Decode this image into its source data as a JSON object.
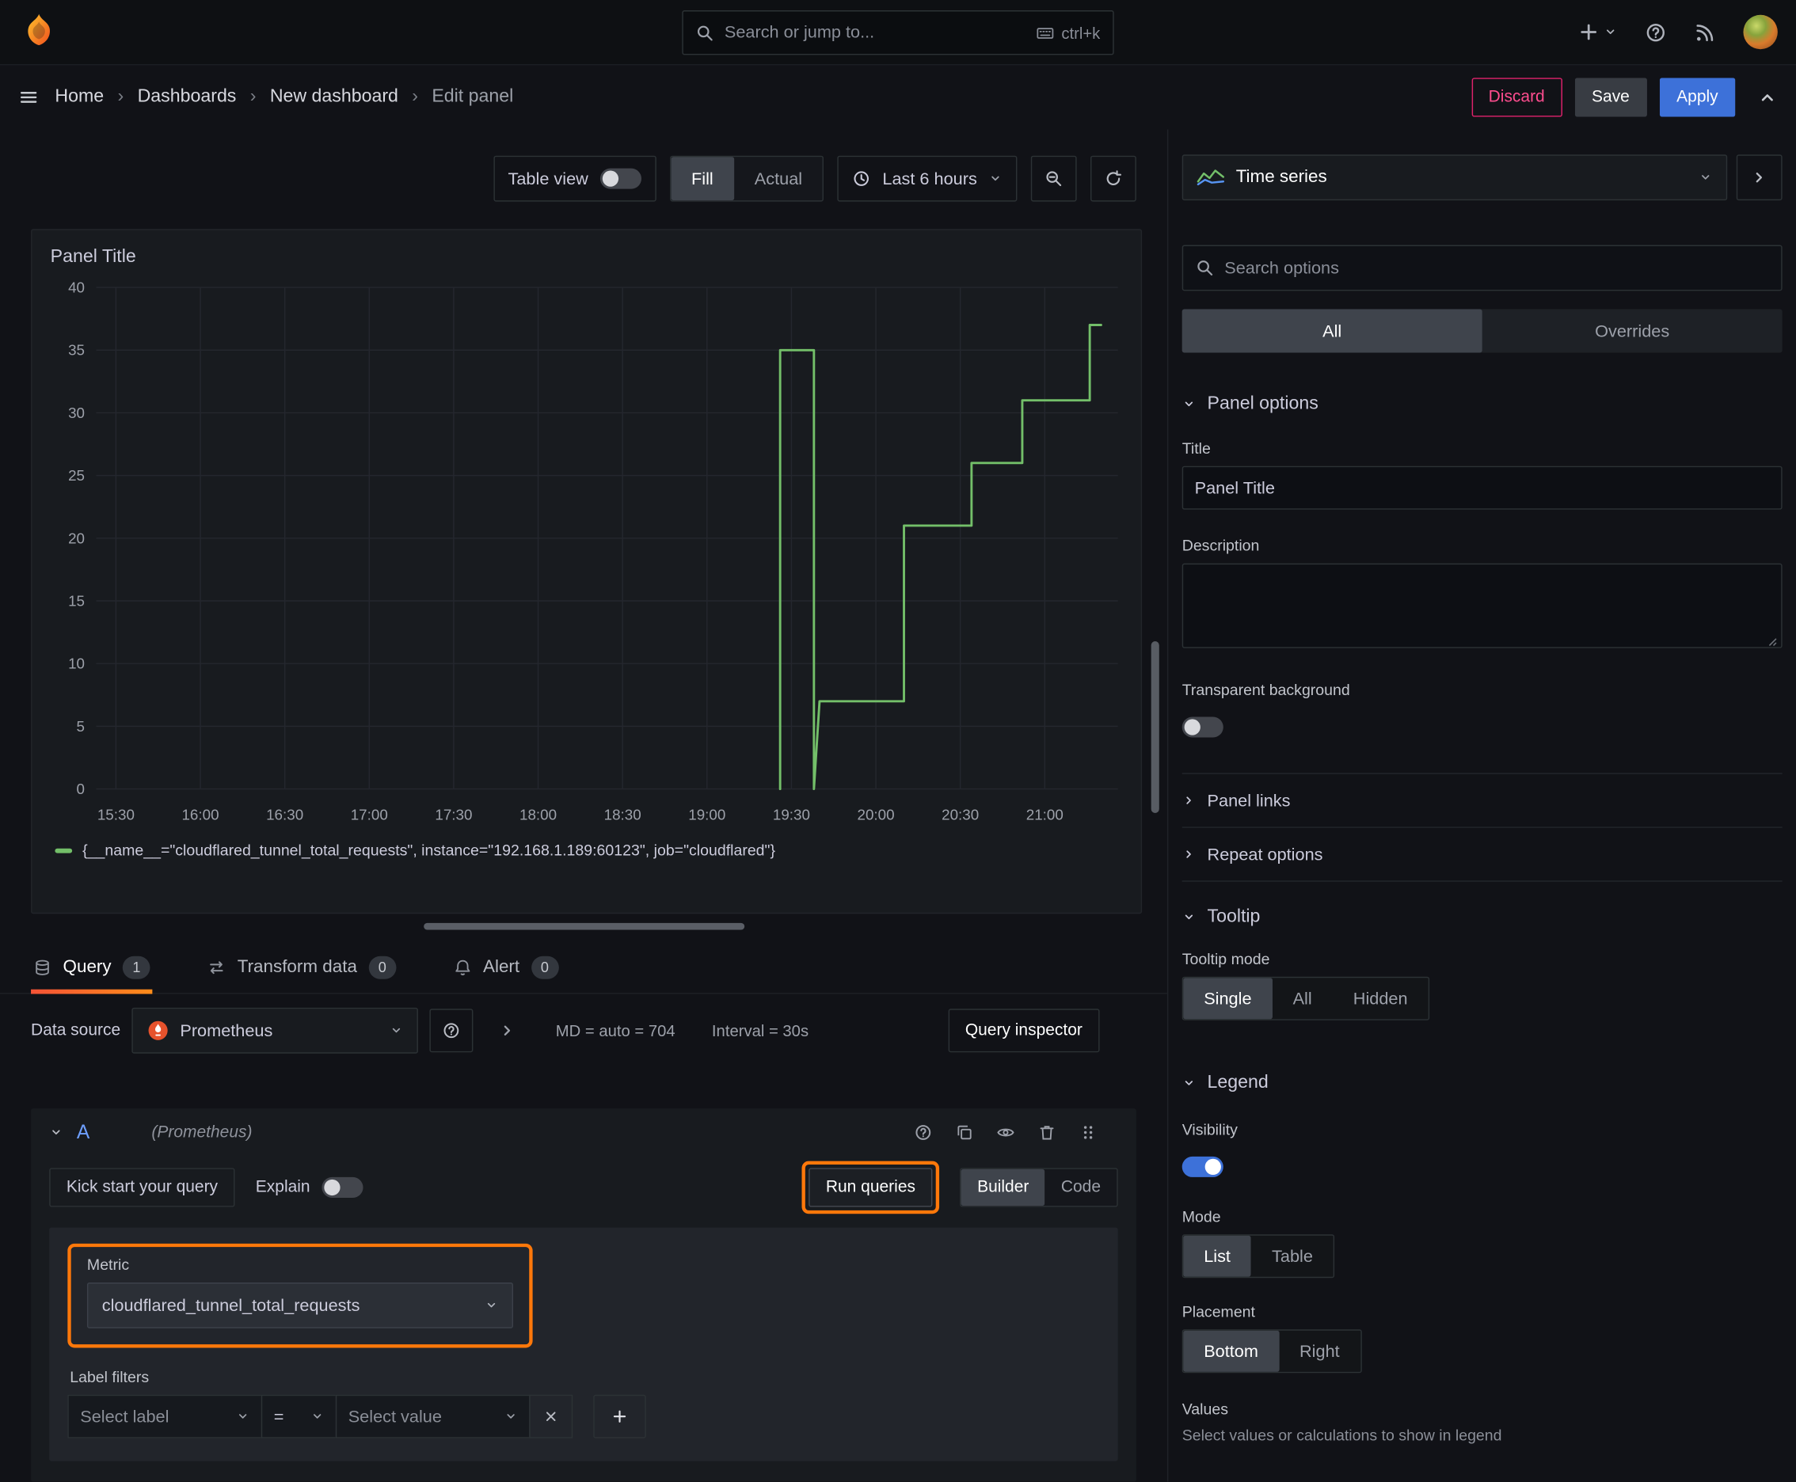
{
  "topnav": {
    "search_placeholder": "Search or jump to...",
    "shortcut": "ctrl+k"
  },
  "breadcrumb": {
    "items": [
      "Home",
      "Dashboards",
      "New dashboard",
      "Edit panel"
    ],
    "discard": "Discard",
    "save": "Save",
    "apply": "Apply"
  },
  "toolbar": {
    "table_view": "Table view",
    "fill": "Fill",
    "actual": "Actual",
    "time_range": "Last 6 hours"
  },
  "panel": {
    "title": "Panel Title",
    "legend": "{__name__=\"cloudflared_tunnel_total_requests\", instance=\"192.168.1.189:60123\", job=\"cloudflared\"}"
  },
  "chart_data": {
    "type": "line",
    "step": true,
    "title": "Panel Title",
    "x_ticks": [
      "15:30",
      "16:00",
      "16:30",
      "17:00",
      "17:30",
      "18:00",
      "18:30",
      "19:00",
      "19:30",
      "20:00",
      "20:30",
      "21:00"
    ],
    "x_range": [
      "15:23",
      "21:26"
    ],
    "y_ticks": [
      0,
      5,
      10,
      15,
      20,
      25,
      30,
      35,
      40
    ],
    "ylim": [
      0,
      40
    ],
    "grid": true,
    "legend_position": "bottom",
    "series": [
      {
        "name": "{__name__=\"cloudflared_tunnel_total_requests\", instance=\"192.168.1.189:60123\", job=\"cloudflared\"}",
        "color": "#73bf69",
        "points": [
          [
            "19:26",
            0
          ],
          [
            "19:26",
            35
          ],
          [
            "19:38",
            35
          ],
          [
            "19:38",
            0
          ],
          [
            "19:40",
            7
          ],
          [
            "20:10",
            7
          ],
          [
            "20:10",
            21
          ],
          [
            "20:34",
            21
          ],
          [
            "20:34",
            26
          ],
          [
            "20:52",
            26
          ],
          [
            "20:52",
            31
          ],
          [
            "21:16",
            31
          ],
          [
            "21:16",
            37
          ],
          [
            "21:20",
            37
          ]
        ]
      }
    ]
  },
  "tabs": {
    "query": "Query",
    "query_count": "1",
    "transform": "Transform data",
    "transform_count": "0",
    "alert": "Alert",
    "alert_count": "0"
  },
  "query": {
    "datasource_label": "Data source",
    "datasource": "Prometheus",
    "stats_md": "MD = auto = 704",
    "stats_interval": "Interval = 30s",
    "inspector": "Query inspector",
    "ref": "A",
    "ref_ds": "(Prometheus)",
    "kickstart": "Kick start your query",
    "explain": "Explain",
    "run": "Run queries",
    "builder": "Builder",
    "code": "Code",
    "metric_label": "Metric",
    "metric_value": "cloudflared_tunnel_total_requests",
    "label_filters": "Label filters",
    "select_label": "Select label",
    "operator": "=",
    "select_value": "Select value"
  },
  "sidebar": {
    "viz": "Time series",
    "search_placeholder": "Search options",
    "tab_all": "All",
    "tab_overrides": "Overrides",
    "panel_options": "Panel options",
    "title_label": "Title",
    "title_value": "Panel Title",
    "description_label": "Description",
    "transparent": "Transparent background",
    "panel_links": "Panel links",
    "repeat_options": "Repeat options",
    "tooltip": "Tooltip",
    "tooltip_mode": "Tooltip mode",
    "tooltip_options": [
      "Single",
      "All",
      "Hidden"
    ],
    "tooltip_selected": "Single",
    "legend": "Legend",
    "visibility": "Visibility",
    "mode": "Mode",
    "mode_options": [
      "List",
      "Table"
    ],
    "mode_selected": "List",
    "placement": "Placement",
    "placement_options": [
      "Bottom",
      "Right"
    ],
    "placement_selected": "Bottom",
    "values_label": "Values",
    "values_help": "Select values or calculations to show in legend"
  },
  "toggles": {
    "table_view": false,
    "explain": false,
    "transparent_background": false,
    "legend_visibility": true
  }
}
